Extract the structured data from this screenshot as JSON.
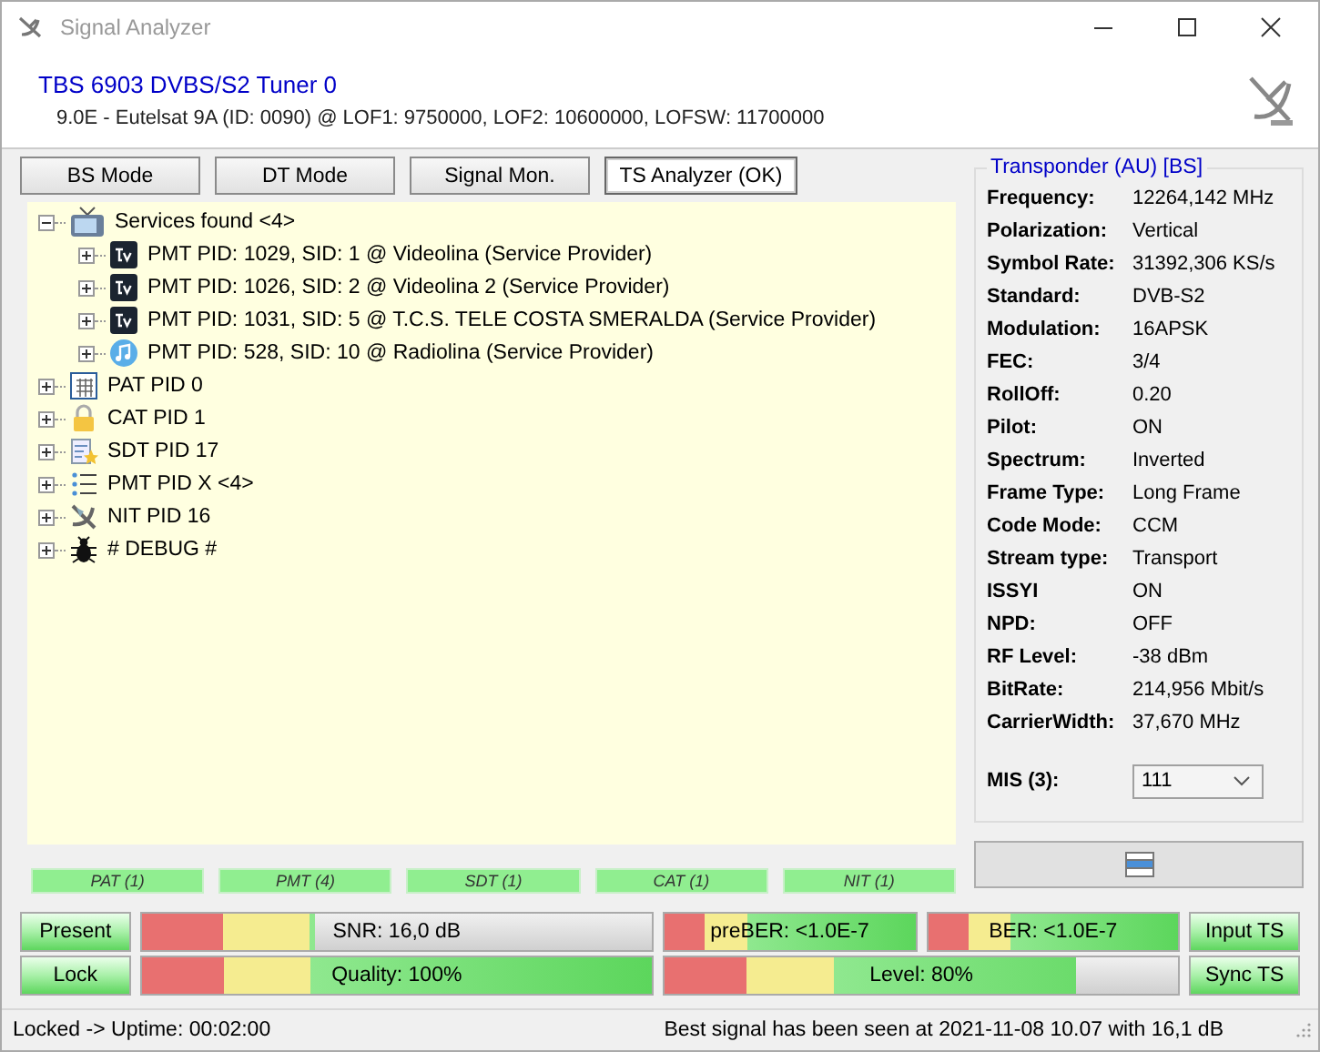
{
  "window": {
    "title": "Signal Analyzer"
  },
  "header": {
    "tuner": "TBS 6903 DVBS/S2 Tuner 0",
    "details": "9.0E - Eutelsat 9A (ID: 0090) @ LOF1: 9750000, LOF2: 10600000, LOFSW: 11700000"
  },
  "tabs": [
    {
      "label": "BS Mode",
      "selected": false
    },
    {
      "label": "DT Mode",
      "selected": false
    },
    {
      "label": "Signal Mon.",
      "selected": false
    },
    {
      "label": "TS Analyzer (OK)",
      "selected": true
    }
  ],
  "tree": [
    {
      "kind": "services",
      "label": "Services found <4>",
      "expanded": true,
      "children": [
        {
          "kind": "tv",
          "label": "PMT PID: 1029, SID: 1 @ Videolina (Service Provider)",
          "expanded": false
        },
        {
          "kind": "tv",
          "label": "PMT PID: 1026, SID: 2 @ Videolina 2 (Service Provider)",
          "expanded": false
        },
        {
          "kind": "tv",
          "label": "PMT PID: 1031, SID: 5 @ T.C.S.  TELE COSTA SMERALDA (Service Provider)",
          "expanded": false
        },
        {
          "kind": "radio",
          "label": "PMT PID: 528, SID: 10 @ Radiolina (Service Provider)",
          "expanded": false
        }
      ]
    },
    {
      "kind": "table",
      "label": "PAT PID 0",
      "expanded": false
    },
    {
      "kind": "lock",
      "label": "CAT PID 1",
      "expanded": false
    },
    {
      "kind": "sdt",
      "label": "SDT PID 17",
      "expanded": false
    },
    {
      "kind": "list",
      "label": "PMT PID X <4>",
      "expanded": false
    },
    {
      "kind": "satellite",
      "label": "NIT PID 16",
      "expanded": false
    },
    {
      "kind": "bug",
      "label": "# DEBUG #",
      "expanded": false
    }
  ],
  "table_tags": [
    "PAT (1)",
    "PMT (4)",
    "SDT (1)",
    "CAT (1)",
    "NIT (1)"
  ],
  "transponder": {
    "title": "Transponder (AU) [BS]",
    "fields": [
      {
        "label": "Frequency:",
        "value": "12264,142 MHz"
      },
      {
        "label": "Polarization:",
        "value": "Vertical"
      },
      {
        "label": "Symbol Rate:",
        "value": "31392,306 KS/s"
      },
      {
        "label": "Standard:",
        "value": "DVB-S2"
      },
      {
        "label": "Modulation:",
        "value": "16APSK"
      },
      {
        "label": "FEC:",
        "value": "3/4"
      },
      {
        "label": "RollOff:",
        "value": "0.20"
      },
      {
        "label": "Pilot:",
        "value": "ON"
      },
      {
        "label": "Spectrum:",
        "value": "Inverted"
      },
      {
        "label": "Frame Type:",
        "value": "Long Frame"
      },
      {
        "label": "Code Mode:",
        "value": "CCM"
      },
      {
        "label": "Stream type:",
        "value": "Transport"
      },
      {
        "label": "ISSYI",
        "value": "ON"
      },
      {
        "label": "NPD:",
        "value": "OFF"
      },
      {
        "label": "RF Level:",
        "value": "-38 dBm"
      },
      {
        "label": "BitRate:",
        "value": "214,956 Mbit/s"
      },
      {
        "label": "CarrierWidth:",
        "value": "37,670 MHz"
      }
    ],
    "mis": {
      "label": "MIS (3):",
      "value": "111"
    }
  },
  "indicators": {
    "present": {
      "label": "Present",
      "on": true
    },
    "lock": {
      "label": "Lock",
      "on": true
    },
    "input_ts": {
      "label": "Input TS",
      "on": true
    },
    "sync_ts": {
      "label": "Sync TS",
      "on": true
    }
  },
  "meters": {
    "snr": {
      "label": "SNR: 16,0 dB",
      "level": 0.34
    },
    "pre_ber": {
      "label": "preBER: <1.0E-7",
      "level": 1
    },
    "ber": {
      "label": "BER: <1.0E-7",
      "level": 1
    },
    "quality": {
      "label": "Quality: 100%",
      "level": 1
    },
    "signal_level": {
      "label": "Level: 80%",
      "level": 0.8
    }
  },
  "status_bar": {
    "left": "Locked -> Uptime: 00:02:00",
    "right": "Best signal has been seen at 2021-11-08 10.07 with 16,1 dB"
  }
}
